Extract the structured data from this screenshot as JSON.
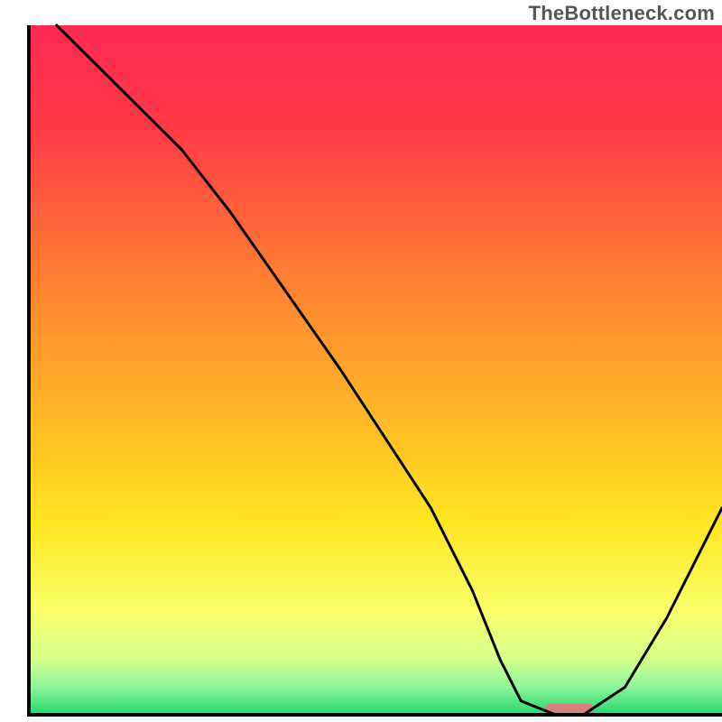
{
  "watermark": "TheBottleneck.com",
  "chart_data": {
    "type": "line",
    "title": "",
    "xlabel": "",
    "ylabel": "",
    "xlim": [
      0,
      100
    ],
    "ylim": [
      0,
      100
    ],
    "grid": false,
    "legend": false,
    "x": [
      4,
      12,
      22,
      29,
      45,
      58,
      64,
      68,
      71,
      76,
      80,
      86,
      92,
      100
    ],
    "values": [
      100,
      92,
      82,
      73,
      50,
      30,
      18,
      8,
      2,
      0,
      0,
      4,
      14,
      30
    ],
    "marker": {
      "x": 78,
      "y": 0.7,
      "w": 7,
      "h": 1.8,
      "color": "#d98080"
    },
    "gradient_stops": [
      {
        "offset": 0,
        "color": "#ff2a55"
      },
      {
        "offset": 15,
        "color": "#ff3a47"
      },
      {
        "offset": 35,
        "color": "#ff7a33"
      },
      {
        "offset": 55,
        "color": "#ffb327"
      },
      {
        "offset": 72,
        "color": "#ffe61f"
      },
      {
        "offset": 85,
        "color": "#f9ff6a"
      },
      {
        "offset": 92,
        "color": "#d6ff8c"
      },
      {
        "offset": 96,
        "color": "#8cf59d"
      },
      {
        "offset": 100,
        "color": "#23d86b"
      }
    ],
    "axis_color": "#000000",
    "line_color": "#000000"
  }
}
